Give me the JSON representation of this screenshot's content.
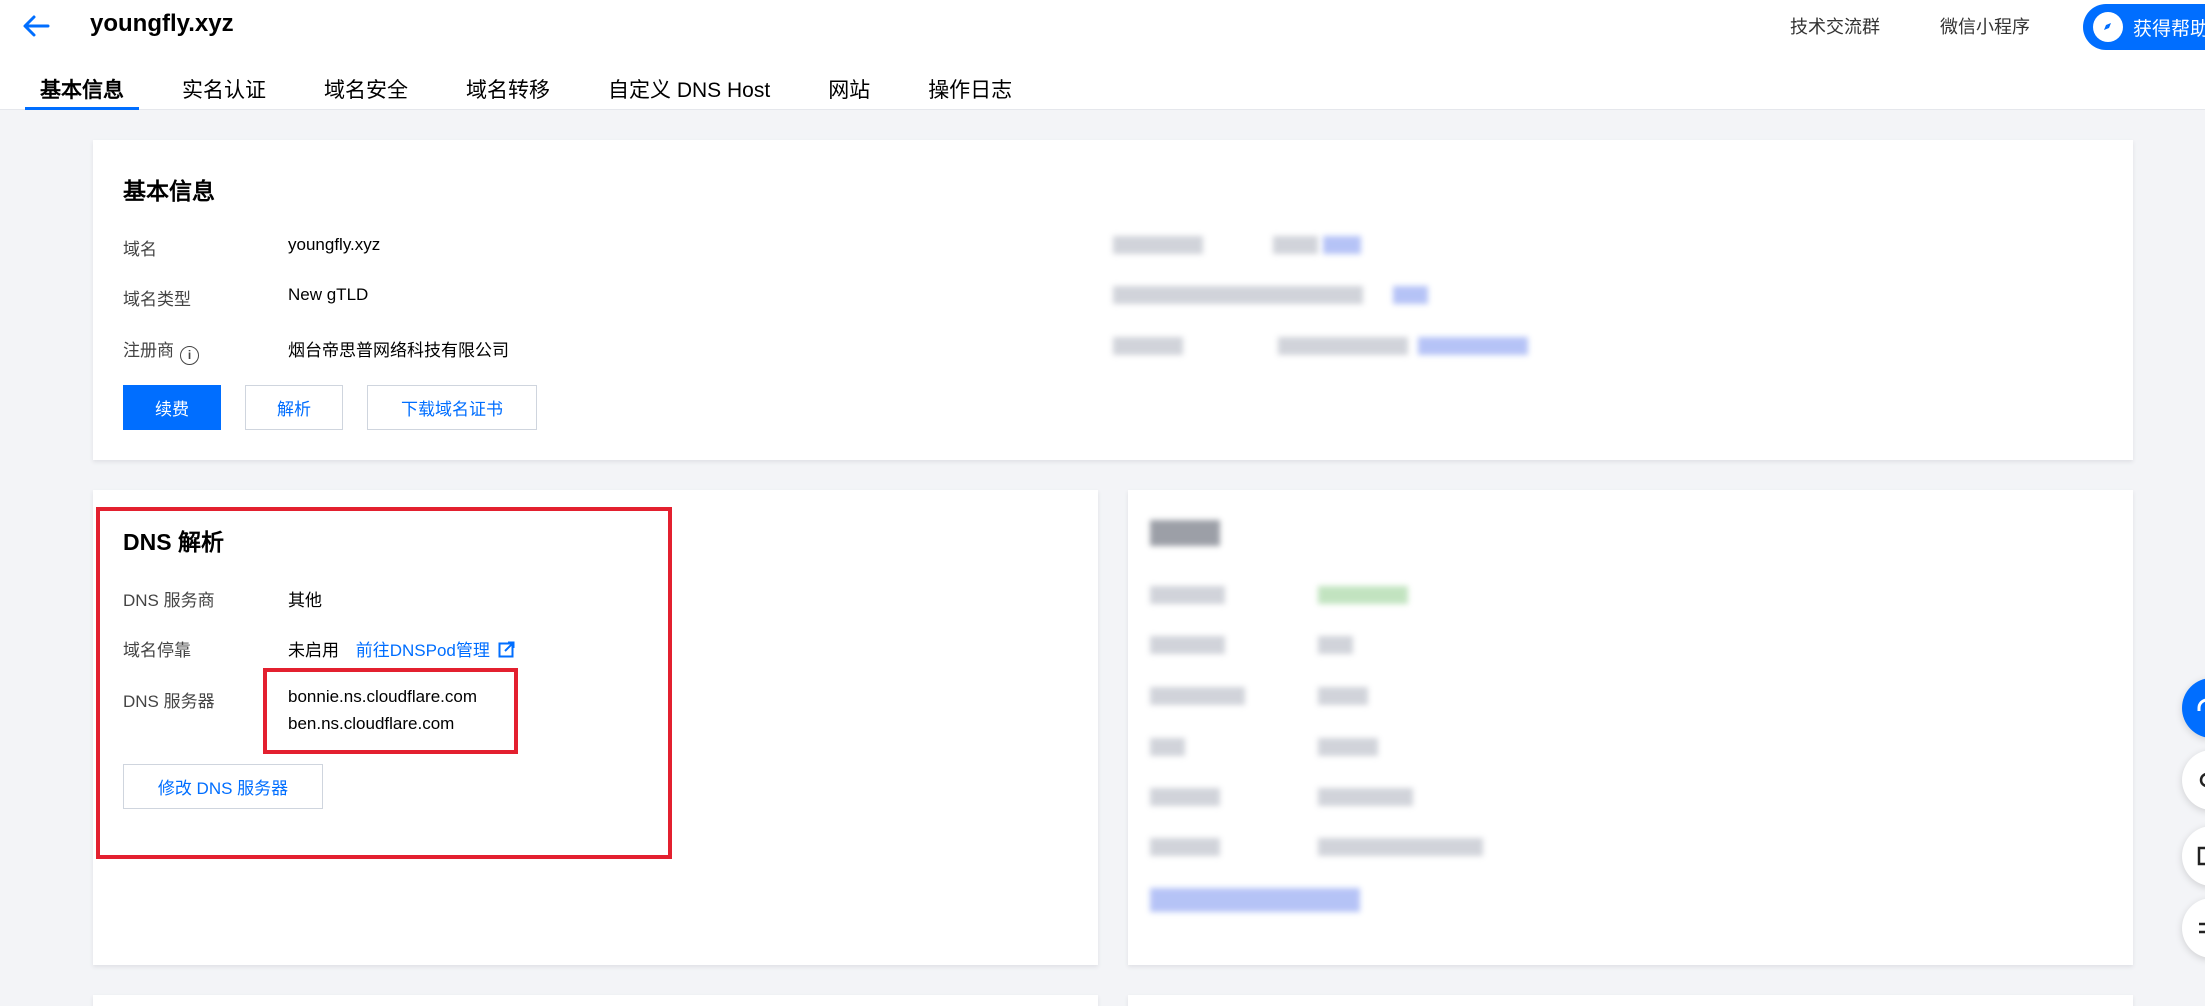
{
  "header": {
    "title": "youngfly.xyz",
    "links": [
      "技术交流群",
      "微信小程序"
    ],
    "help_label": "获得帮助"
  },
  "tabs": [
    "基本信息",
    "实名认证",
    "域名安全",
    "域名转移",
    "自定义 DNS Host",
    "网站",
    "操作日志"
  ],
  "basic": {
    "title": "基本信息",
    "rows": [
      {
        "label": "域名",
        "value": "youngfly.xyz"
      },
      {
        "label": "域名类型",
        "value": "New gTLD"
      },
      {
        "label": "注册商",
        "value": "烟台帝思普网络科技有限公司"
      }
    ],
    "buttons": {
      "renew": "续费",
      "resolve": "解析",
      "download_cert": "下载域名证书"
    }
  },
  "dns": {
    "title": "DNS 解析",
    "provider_label": "DNS 服务商",
    "provider_value": "其他",
    "parking_label": "域名停靠",
    "parking_value": "未启用",
    "parking_link": "前往DNSPod管理",
    "servers_label": "DNS 服务器",
    "servers": [
      "bonnie.ns.cloudflare.com",
      "ben.ns.cloudflare.com"
    ],
    "modify_button": "修改 DNS 服务器"
  },
  "colors": {
    "accent": "#006eff",
    "highlight": "#e3202f"
  }
}
